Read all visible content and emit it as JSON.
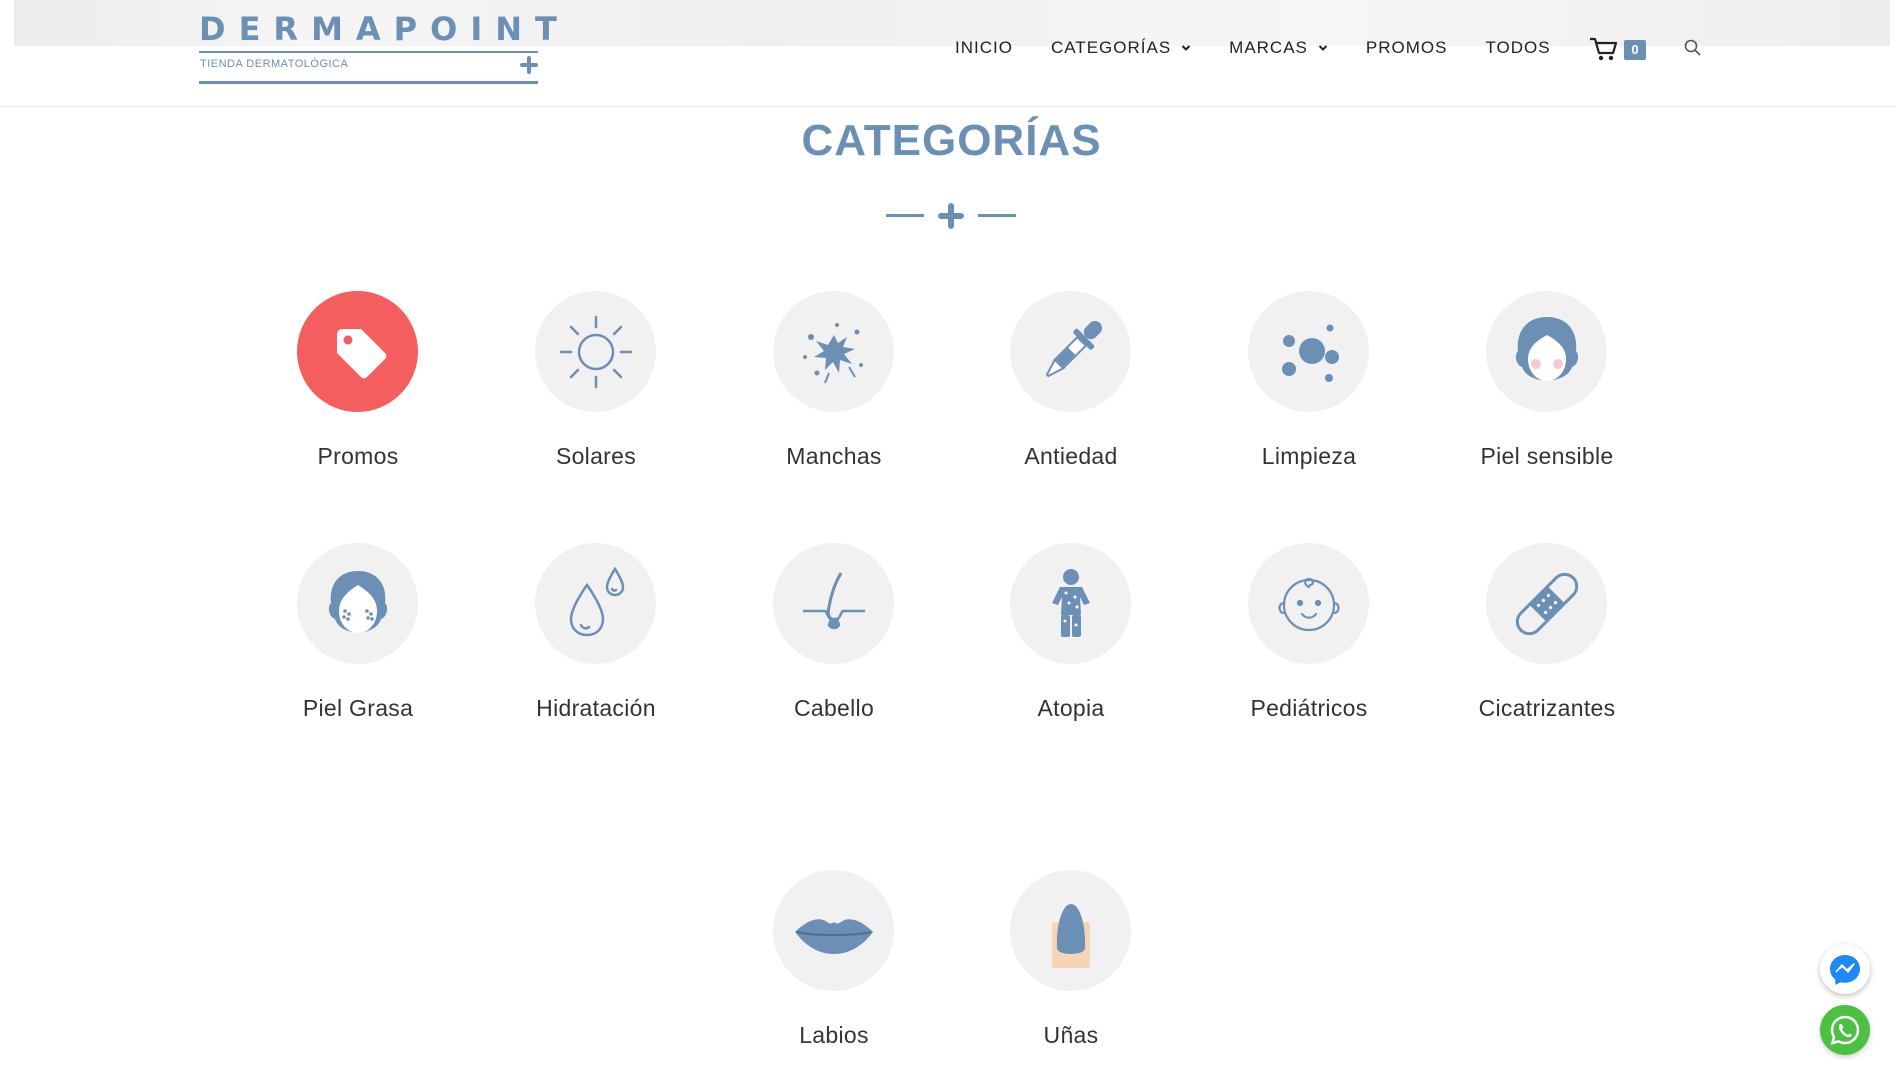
{
  "brand": {
    "name": "DERMAPOINT",
    "tagline": "TIENDA DERMATOLÓGICA",
    "color": "#6c8fb6"
  },
  "nav": {
    "items": [
      "INICIO",
      "CATEGORÍAS",
      "MARCAS",
      "PROMOS",
      "TODOS"
    ],
    "cart_count": "0"
  },
  "main": {
    "title": "CATEGORÍAS",
    "categories": [
      {
        "label": "Promos",
        "icon": "tag-icon"
      },
      {
        "label": "Solares",
        "icon": "sun-icon"
      },
      {
        "label": "Manchas",
        "icon": "splatter-icon"
      },
      {
        "label": "Antiedad",
        "icon": "dropper-icon"
      },
      {
        "label": "Limpieza",
        "icon": "bubbles-icon"
      },
      {
        "label": "Piel sensible",
        "icon": "face-blush-icon"
      },
      {
        "label": "Piel Grasa",
        "icon": "face-oily-icon"
      },
      {
        "label": "Hidratación",
        "icon": "droplets-icon"
      },
      {
        "label": "Cabello",
        "icon": "hair-follicle-icon"
      },
      {
        "label": "Atopia",
        "icon": "child-spots-icon"
      },
      {
        "label": "Pediátricos",
        "icon": "baby-face-icon"
      },
      {
        "label": "Cicatrizantes",
        "icon": "bandage-icon"
      },
      {
        "label": "Labios",
        "icon": "lips-icon"
      },
      {
        "label": "Uñas",
        "icon": "nail-icon"
      }
    ]
  },
  "colors": {
    "accent": "#6c8fb6",
    "promo": "#f45e5e",
    "whatsapp": "#4cc043",
    "messenger": "#1e88f5"
  }
}
